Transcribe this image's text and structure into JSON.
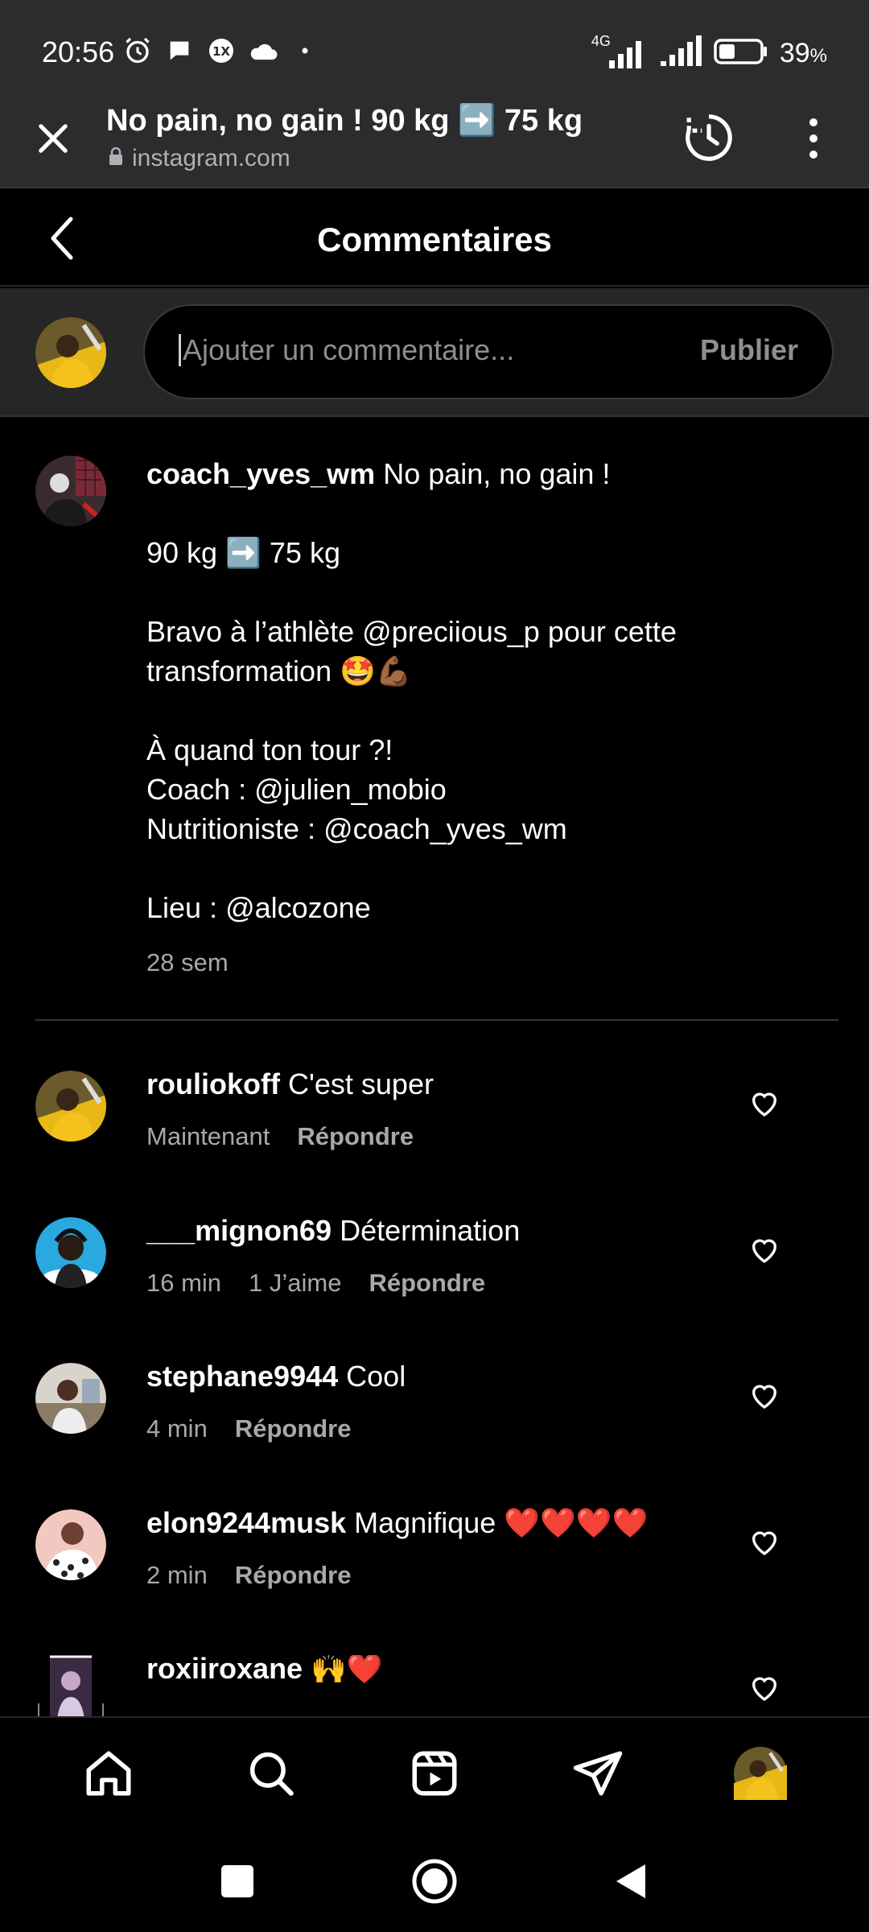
{
  "status_bar": {
    "time": "20:56",
    "network": "4G",
    "battery_pct": "39",
    "battery_unit": "%",
    "battery_level": 0.39
  },
  "browser": {
    "page_title": "No pain, no gain ! 90 kg ➡️ 75 kg",
    "url": "instagram.com"
  },
  "header": {
    "title": "Commentaires"
  },
  "composer": {
    "placeholder": "Ajouter un commentaire...",
    "publish_label": "Publier"
  },
  "caption": {
    "username": "coach_yves_wm",
    "lines": [
      "No pain, no gain !",
      "",
      "90 kg ➡️ 75 kg",
      "",
      "Bravo à l’athlète @preciious_p pour cette",
      "transformation 🤩💪🏾",
      "",
      "À quand ton tour ?!",
      "Coach : @julien_mobio",
      "Nutritioniste : @coach_yves_wm",
      "",
      "Lieu : @alcozone"
    ],
    "time": "28 sem"
  },
  "comments": [
    {
      "username": "rouliokoff",
      "text": "C'est super",
      "time": "Maintenant",
      "likes": "",
      "reply": "Répondre"
    },
    {
      "username": "___mignon69",
      "text": "Détermination",
      "time": "16 min",
      "likes": "1 J’aime",
      "reply": "Répondre"
    },
    {
      "username": "stephane9944",
      "text": "Cool",
      "time": "4 min",
      "likes": "",
      "reply": "Répondre"
    },
    {
      "username": "elon9244musk",
      "text": "Magnifique ❤️❤️❤️❤️",
      "time": "2 min",
      "likes": "",
      "reply": "Répondre"
    },
    {
      "username": "roxiiroxane",
      "text": "🙌❤️",
      "time": "",
      "likes": "",
      "reply": ""
    }
  ],
  "colors": {
    "background": "#000000",
    "chrome": "#2c2c2e",
    "secondary_text": "#a8a8a8"
  }
}
